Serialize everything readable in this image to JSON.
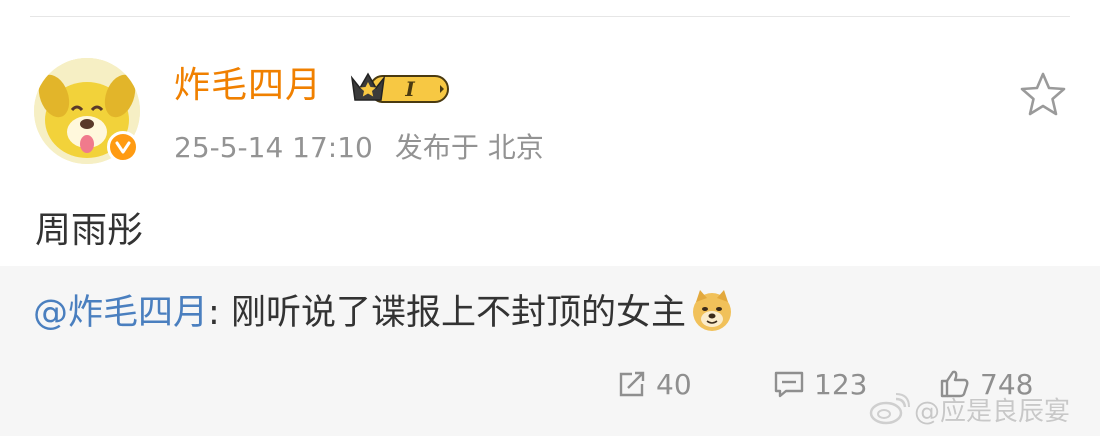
{
  "post": {
    "author": {
      "name": "炸毛四月",
      "vip_level": "I",
      "avatar_icon": "dog-avatar-icon",
      "verified_icon": "verified-badge-icon"
    },
    "time": "25-5-14 17:10",
    "location": "发布于 北京",
    "text": "周雨彤",
    "quote": {
      "mention": "@炸毛四月",
      "separator": ": ",
      "text": "刚听说了谍报上不封顶的女主",
      "emoji_icon": "doge-emoji-icon"
    },
    "actions": {
      "repost_count": "40",
      "comment_count": "123",
      "like_count": "748"
    }
  },
  "watermark": "@应是良辰宴",
  "colors": {
    "username": "#f08000",
    "mention": "#4a7fbf",
    "meta": "#939393",
    "quote_bg": "#f6f6f6"
  }
}
